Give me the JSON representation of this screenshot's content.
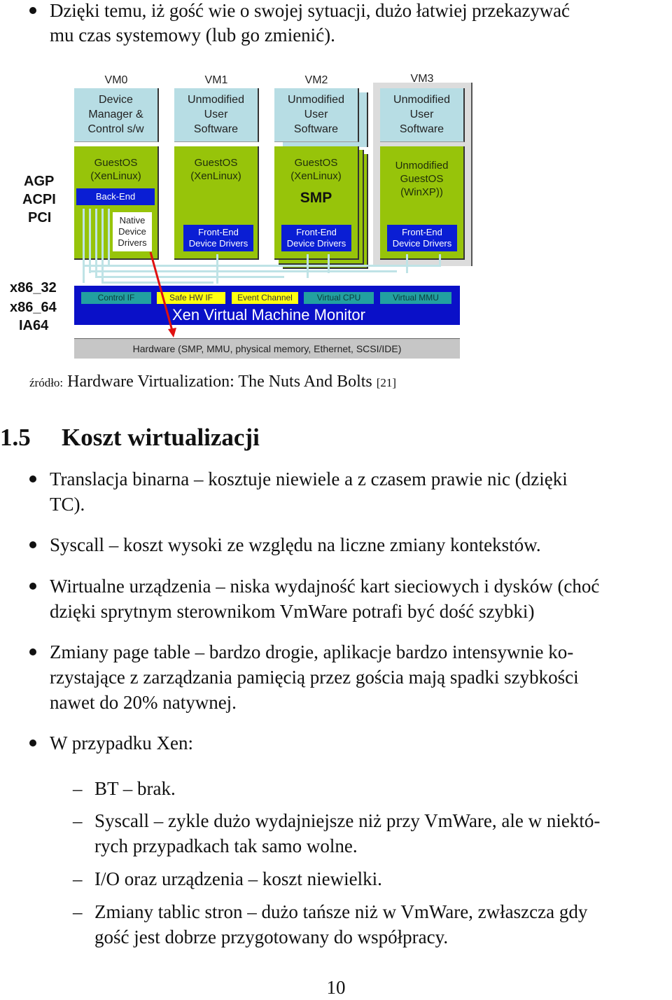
{
  "intro_bullet": {
    "line1": "Dzięki temu, iż gość wie o swojej sytuacji, dużo łatwiej przekazywać",
    "line2": "mu czas systemowy (lub go zmienić)."
  },
  "diagram": {
    "side_labels_top": [
      "AGP",
      "ACPI",
      "PCI"
    ],
    "side_labels_bottom": [
      "x86_32",
      "x86_64",
      "IA64"
    ],
    "vms": [
      {
        "label": "VM0",
        "user": [
          "Device",
          "Manager &",
          "Control s/w"
        ],
        "os": [
          "GuestOS",
          "(XenLinux)"
        ],
        "backend": "Back-End",
        "native": [
          "Native",
          "Device",
          "Drivers"
        ]
      },
      {
        "label": "VM1",
        "user": [
          "Unmodified",
          "User",
          "Software"
        ],
        "os": [
          "GuestOS",
          "(XenLinux)"
        ],
        "frontend": [
          "Front-End",
          "Device Drivers"
        ]
      },
      {
        "label": "VM2",
        "user": [
          "Unmodified",
          "User",
          "Software"
        ],
        "os": [
          "GuestOS",
          "(XenLinux)"
        ],
        "extra": "SMP",
        "frontend": [
          "Front-End",
          "Device Drivers"
        ]
      },
      {
        "label": "VM3",
        "user": [
          "Unmodified",
          "User",
          "Software"
        ],
        "os": [
          "Unmodified",
          "GuestOS",
          "(WinXP))"
        ],
        "frontend": [
          "Front-End",
          "Device Drivers"
        ]
      }
    ],
    "vmm": {
      "title": "Xen Virtual Machine Monitor",
      "chips": [
        "Control IF",
        "Safe HW IF",
        "Event Channel",
        "Virtual CPU",
        "Virtual MMU"
      ]
    },
    "hardware": "Hardware (SMP, MMU, physical memory, Ethernet, SCSI/IDE)",
    "colors": {
      "user": "#b7dde4",
      "guestos": "#97c40a",
      "vmm": "#0a10c8",
      "frontend": "#0a1ed4",
      "chip_teal": "#22a0a0",
      "chip_yellow": "#ffff10",
      "hardware": "#c6c6c6",
      "arrow": "#e01010"
    }
  },
  "caption": {
    "prefix": "źródło:",
    "text": "Hardware Virtualization: The Nuts And Bolts",
    "ref": "[21]"
  },
  "section": {
    "number": "1.5",
    "title": "Koszt wirtualizacji"
  },
  "bullets": [
    {
      "lines": [
        "Translacja binarna – kosztuje niewiele a z czasem prawie nic (dzięki",
        "TC)."
      ]
    },
    {
      "lines": [
        "Syscall – koszt wysoki ze względu na liczne zmiany kontekstów."
      ]
    },
    {
      "lines": [
        "Wirtualne urządzenia – niska wydajność kart sieciowych i dysków (choć",
        "dzięki sprytnym sterownikom VmWare potrafi być dość szybki)"
      ]
    },
    {
      "lines": [
        "Zmiany page table – bardzo drogie, aplikacje bardzo intensywnie ko-",
        "rzystające z zarządzania pamięcią przez gościa mają spadki szybkości",
        "nawet do 20% natywnej."
      ]
    },
    {
      "lines": [
        "W przypadku Xen:"
      ]
    }
  ],
  "sub_bullets": [
    {
      "lines": [
        "BT – brak."
      ]
    },
    {
      "lines": [
        "Syscall – zykle dużo wydajniejsze niż przy VmWare, ale w niektó-",
        "rych przypadkach tak samo wolne."
      ]
    },
    {
      "lines": [
        "I/O oraz urządzenia – koszt niewielki."
      ]
    },
    {
      "lines": [
        "Zmiany tablic stron – dużo tańsze niż w VmWare, zwłaszcza gdy",
        "gość jest dobrze przygotowany do współpracy."
      ]
    }
  ],
  "page_number": "10"
}
